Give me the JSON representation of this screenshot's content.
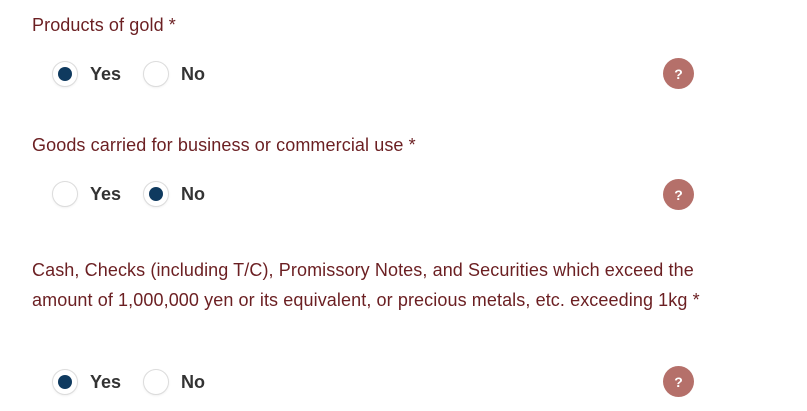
{
  "questions": [
    {
      "label": "Products of gold *",
      "options": [
        {
          "label": "Yes",
          "checked": true
        },
        {
          "label": "No",
          "checked": false
        }
      ],
      "help": "?"
    },
    {
      "label": "Goods carried for business or commercial use *",
      "options": [
        {
          "label": "Yes",
          "checked": false
        },
        {
          "label": "No",
          "checked": true
        }
      ],
      "help": "?"
    },
    {
      "label": "Cash, Checks (including T/C), Promissory Notes, and Securities which exceed the amount of 1,000,000 yen or its equivalent, or precious metals, etc. exceeding 1kg *",
      "options": [
        {
          "label": "Yes",
          "checked": true
        },
        {
          "label": "No",
          "checked": false
        }
      ],
      "help": "?"
    }
  ],
  "colors": {
    "label": "#6b1f22",
    "radio_checked": "#0f3a5f",
    "help_badge": "#b5706a",
    "option_text": "#333333"
  }
}
